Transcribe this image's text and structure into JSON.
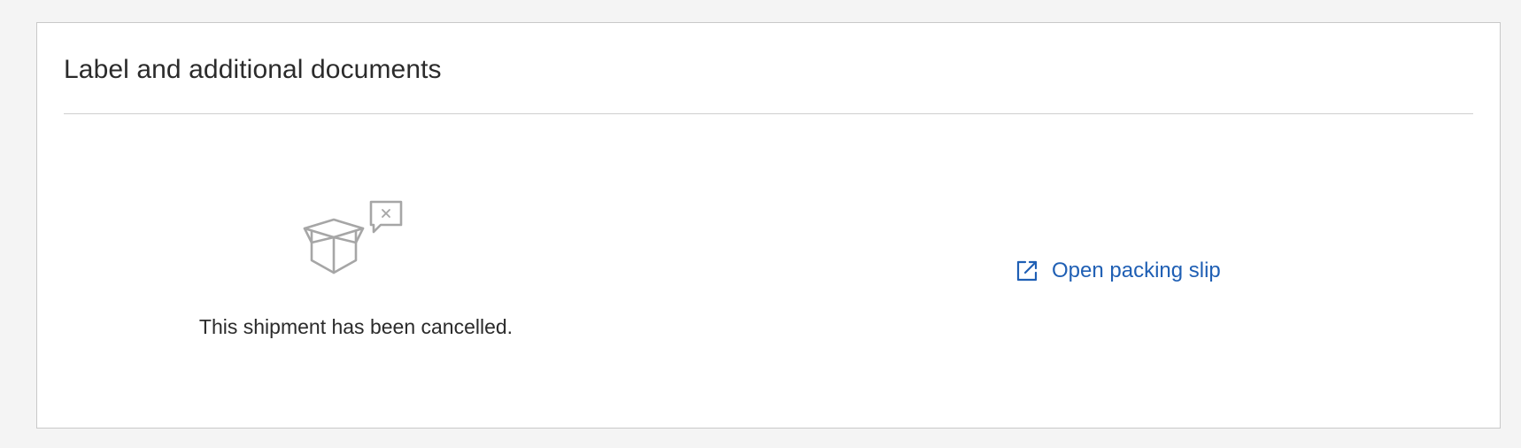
{
  "card": {
    "title": "Label and additional documents"
  },
  "empty_state": {
    "icon": "cancelled-box-icon",
    "message": "This shipment has been cancelled."
  },
  "actions": {
    "packing_slip": {
      "label": "Open packing slip",
      "icon": "external-link-icon"
    }
  },
  "colors": {
    "link": "#1f5fb4",
    "icon_gray": "#a6a6a6",
    "text": "#2b2b2b",
    "border": "#c9c9c9"
  }
}
